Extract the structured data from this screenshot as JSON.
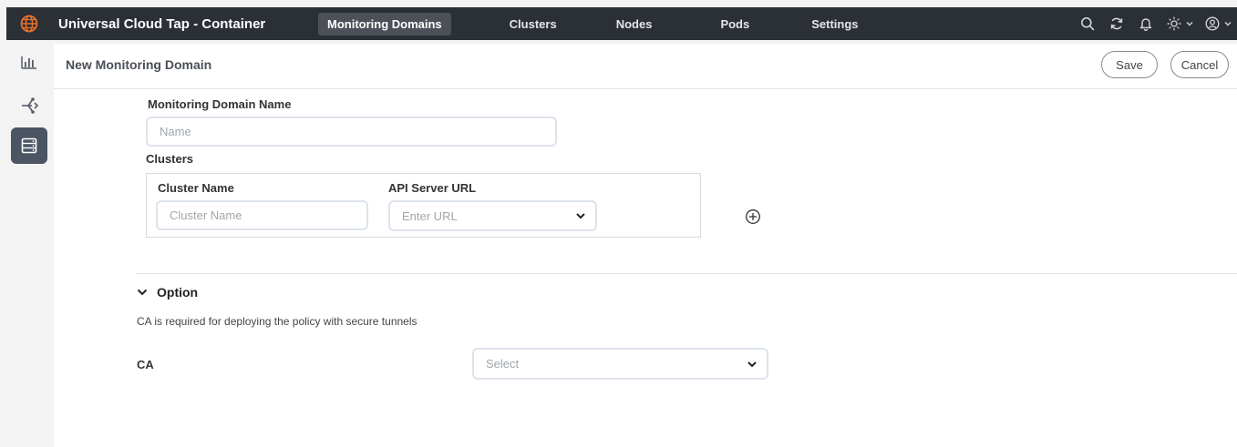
{
  "app": {
    "title": "Universal Cloud Tap - Container",
    "logo_icon": "globe-icon",
    "accent_color": "#e8722a"
  },
  "nav": {
    "items": [
      {
        "label": "Monitoring Domains",
        "active": true
      },
      {
        "label": "Clusters",
        "active": false
      },
      {
        "label": "Nodes",
        "active": false
      },
      {
        "label": "Pods",
        "active": false
      },
      {
        "label": "Settings",
        "active": false
      }
    ]
  },
  "top_icons": [
    "search-icon",
    "refresh-icon",
    "bell-icon",
    "sun-icon",
    "user-icon"
  ],
  "sidebar": {
    "items": [
      {
        "icon": "bar-chart-icon",
        "active": false
      },
      {
        "icon": "network-icon",
        "active": false
      },
      {
        "icon": "server-icon",
        "active": true
      }
    ]
  },
  "page": {
    "title": "New Monitoring Domain",
    "save_label": "Save",
    "cancel_label": "Cancel"
  },
  "form": {
    "domain_name_label": "Monitoring Domain Name",
    "domain_name_placeholder": "Name",
    "clusters_label": "Clusters",
    "cluster_name_label": "Cluster Name",
    "cluster_name_placeholder": "Cluster Name",
    "api_url_label": "API Server URL",
    "api_url_placeholder": "Enter URL",
    "option_label": "Option",
    "option_help": "CA is required for deploying the policy with secure tunnels",
    "ca_label": "CA",
    "ca_placeholder": "Select"
  }
}
